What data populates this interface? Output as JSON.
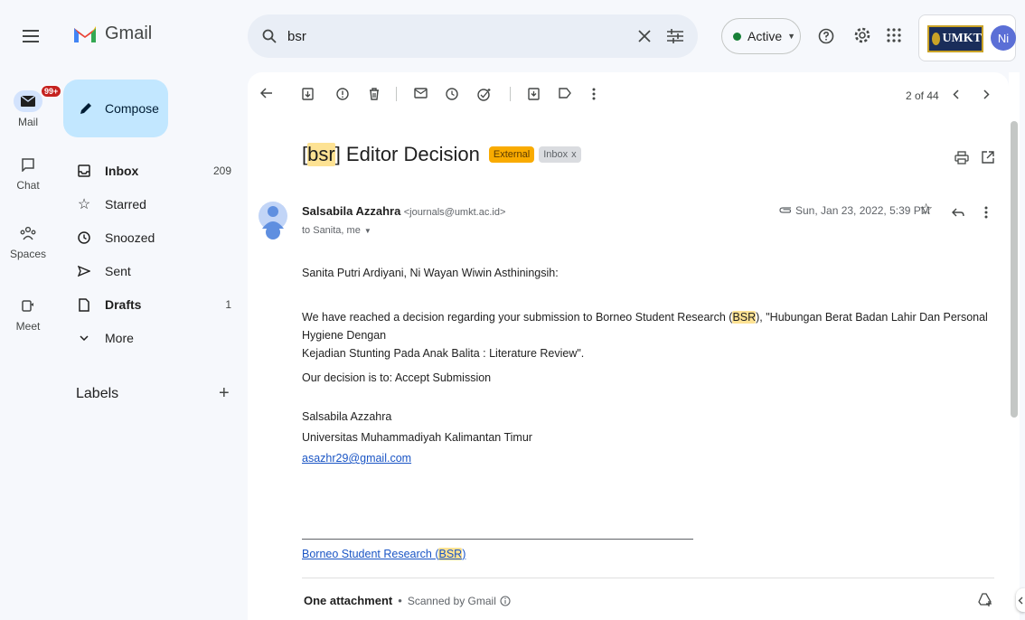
{
  "app": {
    "name": "Gmail"
  },
  "search": {
    "query": "bsr"
  },
  "status": {
    "label": "Active"
  },
  "org_logo_text": "UMKT",
  "avatar_initials": "Ni",
  "rail": {
    "mail_badge": "99+",
    "items": [
      {
        "label": "Mail",
        "icon": "mail-icon"
      },
      {
        "label": "Chat",
        "icon": "chat-icon"
      },
      {
        "label": "Spaces",
        "icon": "spaces-icon"
      },
      {
        "label": "Meet",
        "icon": "meet-icon"
      }
    ]
  },
  "compose": {
    "label": "Compose"
  },
  "nav": {
    "items": [
      {
        "label": "Inbox",
        "count": "209",
        "icon": "inbox-icon"
      },
      {
        "label": "Starred",
        "count": "",
        "icon": "star-icon"
      },
      {
        "label": "Snoozed",
        "count": "",
        "icon": "clock-icon"
      },
      {
        "label": "Sent",
        "count": "",
        "icon": "send-icon"
      },
      {
        "label": "Drafts",
        "count": "1",
        "icon": "draft-icon"
      },
      {
        "label": "More",
        "count": "",
        "icon": "chevron-down-icon"
      }
    ],
    "labels_heading": "Labels"
  },
  "pagination": {
    "text": "2 of 44"
  },
  "email": {
    "subject_prefix": "bsr",
    "subject_rest": "] Editor Decision",
    "subject_bracket": "[",
    "tag_external": "External",
    "tag_inbox": "Inbox",
    "sender_name": "Salsabila Azzahra",
    "sender_email": "<journals@umkt.ac.id>",
    "recipients": "to Sanita, me",
    "date": "Sun, Jan 23, 2022, 5:39 PM",
    "body": {
      "greeting": "Sanita Putri Ardiyani, Ni Wayan Wiwin Asthiningsih:",
      "p1_a": "We have reached a decision regarding your submission to Borneo Student Research (",
      "p1_hl": "BSR",
      "p1_b": "), \"Hubungan Berat Badan Lahir Dan Personal Hygiene Dengan",
      "p1_c": "Kejadian Stunting Pada Anak Balita : Literature Review\".",
      "decision": "Our decision is to: Accept Submission",
      "sig_name": "Salsabila Azzahra",
      "sig_org": "Universitas Muhammadiyah Kalimantan Timur",
      "sig_email": "asazhr29@gmail.com",
      "footer_link_a": "Borneo Student Research (",
      "footer_link_hl": "BSR",
      "footer_link_b": ")"
    },
    "attachment_label": "One attachment",
    "attachment_scan": "Scanned by Gmail"
  },
  "colors": {
    "accent": "#0b57d0",
    "compose_bg": "#c2e7ff",
    "highlight": "#fde293",
    "external_tag": "#f9ab00",
    "active_dot": "#188038"
  }
}
